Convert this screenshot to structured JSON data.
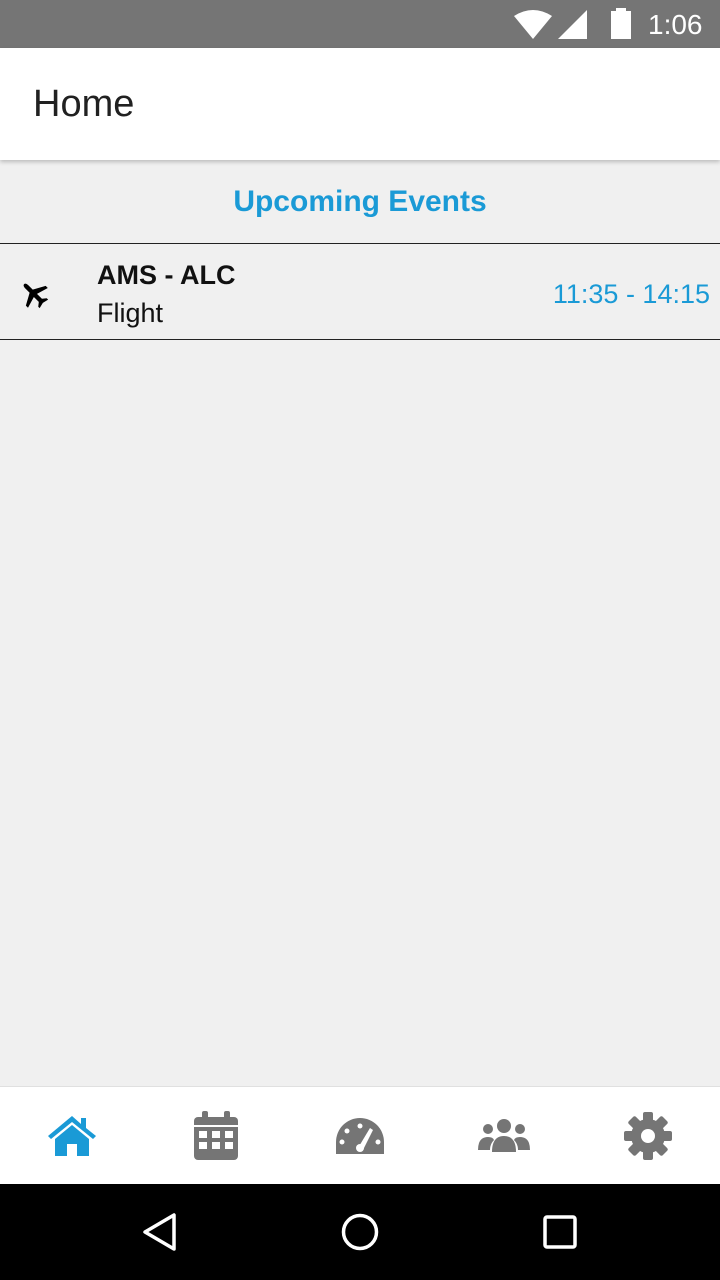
{
  "status_bar": {
    "time": "1:06"
  },
  "app_bar": {
    "title": "Home"
  },
  "section": {
    "title": "Upcoming Events"
  },
  "events": [
    {
      "icon": "airplane-icon",
      "route": "AMS - ALC",
      "type": "Flight",
      "time_range": "11:35 - 14:15"
    }
  ],
  "bottom_nav": {
    "items": [
      {
        "icon": "home-icon",
        "active": true
      },
      {
        "icon": "calendar-icon",
        "active": false
      },
      {
        "icon": "dashboard-icon",
        "active": false
      },
      {
        "icon": "group-icon",
        "active": false
      },
      {
        "icon": "gear-icon",
        "active": false
      }
    ]
  },
  "colors": {
    "accent": "#1a9ad6",
    "inactive_icon": "#757575",
    "status_bar": "#757575"
  }
}
